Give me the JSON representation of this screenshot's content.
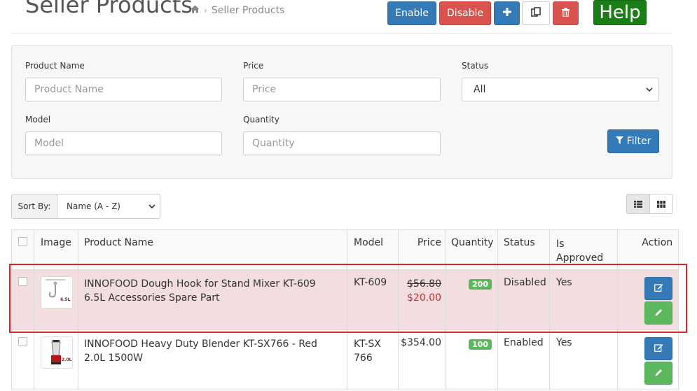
{
  "header": {
    "title": "Seller Products",
    "breadcrumb": [
      "Seller Products"
    ],
    "buttons": {
      "enable": "Enable",
      "disable": "Disable",
      "help": "Help"
    }
  },
  "filters": {
    "product_name": {
      "label": "Product Name",
      "placeholder": "Product Name",
      "value": ""
    },
    "price": {
      "label": "Price",
      "placeholder": "Price",
      "value": ""
    },
    "status": {
      "label": "Status",
      "selected": "All"
    },
    "model": {
      "label": "Model",
      "placeholder": "Model",
      "value": ""
    },
    "quantity": {
      "label": "Quantity",
      "placeholder": "Quantity",
      "value": ""
    },
    "filter_button": "Filter"
  },
  "sort": {
    "label": "Sort By:",
    "selected": "Name (A - Z)"
  },
  "table": {
    "headers": {
      "image": "Image",
      "name": "Product Name",
      "model": "Model",
      "price": "Price",
      "quantity": "Quantity",
      "status": "Status",
      "approved": "Is Approved",
      "action": "Action"
    },
    "rows": [
      {
        "name": "INNOFOOD Dough Hook for Stand Mixer KT-609 6.5L Accessories Spare Part",
        "model": "KT-609",
        "old_price": "$56.80",
        "price": "$20.00",
        "quantity": "200",
        "status": "Disabled",
        "approved": "Yes",
        "thumb_label": "6.5L"
      },
      {
        "name": "INNOFOOD Heavy Duty Blender KT-SX766 - Red 2.0L 1500W",
        "model": "KT-SX766",
        "price": "$354.00",
        "quantity": "100",
        "status": "Enabled",
        "approved": "Yes",
        "thumb_label": "2.0L"
      }
    ]
  },
  "colors": {
    "primary": "#337ab7",
    "danger": "#d9534f",
    "success": "#5cb85c",
    "help_green": "#1a7d16",
    "row_highlight": "#f2dede",
    "highlight_border": "#d9232d"
  }
}
